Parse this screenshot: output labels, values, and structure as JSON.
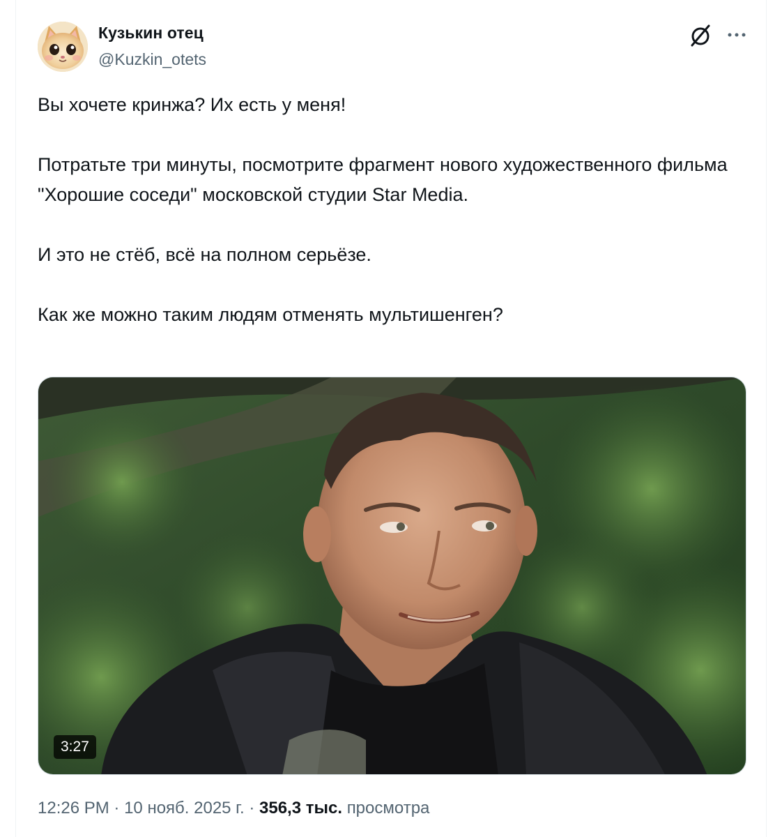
{
  "author": {
    "display_name": "Кузькин отец",
    "handle": "@Kuzkin_otets",
    "avatar_icon": "kitten-avatar"
  },
  "icons": {
    "grok": "grok-icon",
    "more": "more-icon"
  },
  "tweet": {
    "paragraphs": [
      "Вы хочете кринжа? Их есть у меня!",
      "Потратьте три минуты, посмотрите фрагмент нового художественного фильма \"Хорошие соседи\" московской студии Star Media.",
      "И это не стёб, всё на полном серьёзе.",
      "Как же можно таким людям отменять мультишенген?"
    ]
  },
  "media": {
    "type": "video",
    "duration": "3:27"
  },
  "meta": {
    "time": "12:26 PM",
    "separator": "·",
    "date": "10 нояб. 2025 г.",
    "views_count": "356,3 тыс.",
    "views_label": "просмотра"
  },
  "colors": {
    "text": "#0f1419",
    "secondary": "#536471",
    "border": "#cfd9de"
  }
}
